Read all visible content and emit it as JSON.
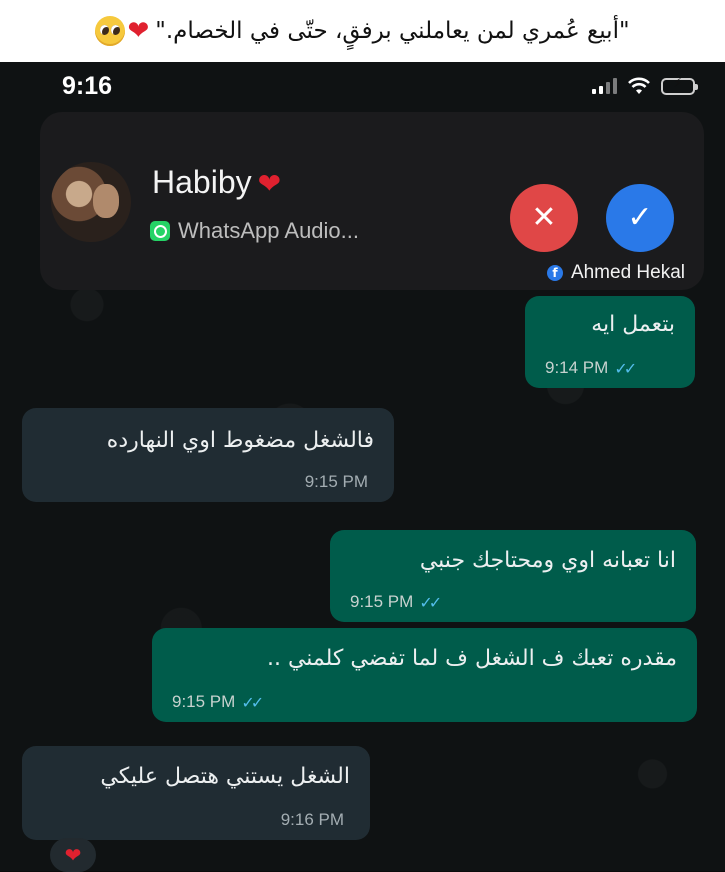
{
  "caption": {
    "text": "\"أبيع عُمري لمن يعاملني برفقٍ، حتّى في الخصام.\"",
    "emojis": [
      "red-heart-icon",
      "pleading-face-icon"
    ]
  },
  "status_bar": {
    "time": "9:16"
  },
  "call_notification": {
    "caller_name": "Habiby",
    "caller_suffix": "❤",
    "subtitle": "WhatsApp Audio...",
    "decline_icon": "✕",
    "accept_icon": "✓",
    "colors": {
      "decline": "#e04747",
      "accept": "#2a79e8"
    }
  },
  "watermark": {
    "text": "Ahmed Hekal",
    "icon": "facebook-icon"
  },
  "messages": [
    {
      "text": "بتعمل ايه",
      "time": "9:14 PM",
      "direction": "outgoing",
      "read": true
    },
    {
      "text": "فالشغل مضغوط اوي النهارده",
      "time": "9:15 PM",
      "direction": "incoming",
      "read": false
    },
    {
      "text": "انا تعبانه اوي ومحتاجك جنبي",
      "time": "9:15 PM",
      "direction": "outgoing",
      "read": true
    },
    {
      "text": "مقدره تعبك ف الشغل ف لما تفضي كلمني ..",
      "time": "9:15 PM",
      "direction": "outgoing",
      "read": true
    },
    {
      "text": "الشغل يستني هتصل عليكي",
      "time": "9:16 PM",
      "direction": "incoming",
      "read": false
    }
  ],
  "reaction": {
    "emoji": "❤"
  },
  "read_receipt": "✓✓"
}
